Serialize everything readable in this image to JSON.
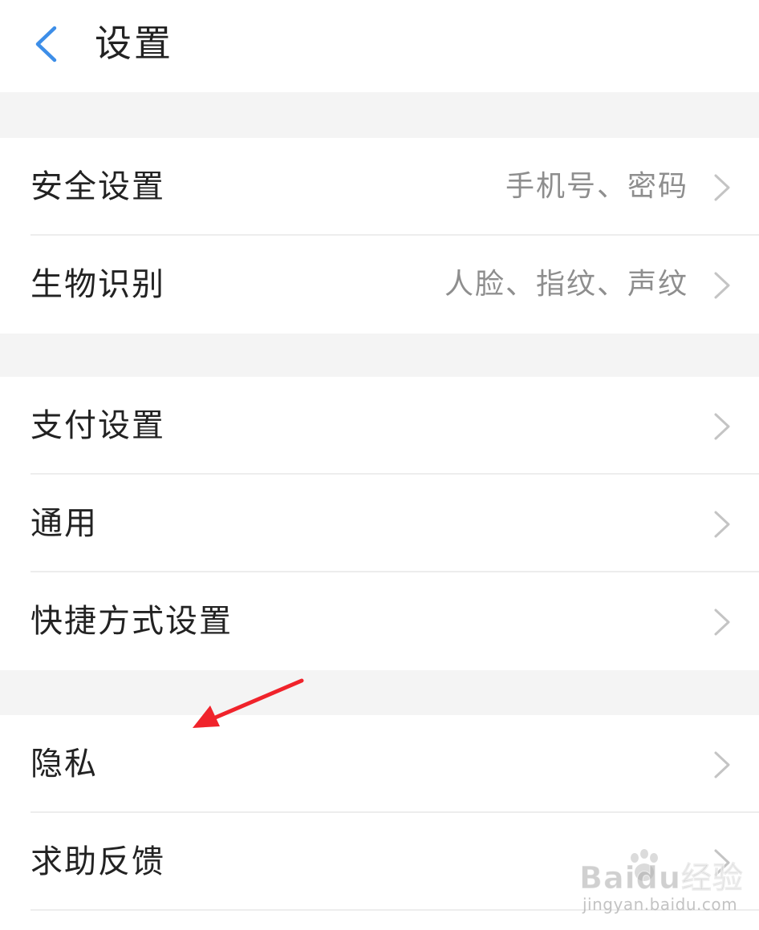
{
  "header": {
    "title": "设置"
  },
  "groups": [
    {
      "items": [
        {
          "label": "安全设置",
          "value": "手机号、密码"
        },
        {
          "label": "生物识别",
          "value": "人脸、指纹、声纹"
        }
      ]
    },
    {
      "items": [
        {
          "label": "支付设置"
        },
        {
          "label": "通用"
        },
        {
          "label": "快捷方式设置"
        }
      ]
    },
    {
      "items": [
        {
          "label": "隐私"
        },
        {
          "label": "求助反馈"
        }
      ]
    }
  ],
  "watermark": {
    "main": "Baidu经验",
    "sub": "jingyan.baidu.com"
  },
  "colors": {
    "accent": "#3d8ee8",
    "annotation_arrow": "#f0232b",
    "background": "#f4f4f4",
    "text_primary": "#222222",
    "text_secondary": "#8e8e8e",
    "chevron": "#c4c4c4"
  },
  "icons": {
    "back": "chevron-left-icon",
    "row": "chevron-right-icon"
  }
}
